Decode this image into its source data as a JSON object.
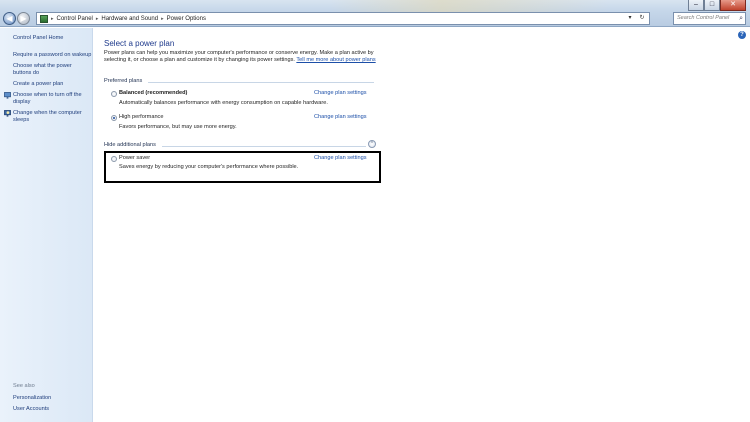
{
  "window": {
    "minimize_glyph": "–",
    "maximize_glyph": "□",
    "close_glyph": "✕"
  },
  "nav": {
    "back_glyph": "◀",
    "forward_glyph": "▶",
    "dropdown_glyph": "▾"
  },
  "address": {
    "crumbs": [
      "Control Panel",
      "Hardware and Sound",
      "Power Options"
    ],
    "separator": "▸",
    "dropdown_glyph": "▾",
    "refresh_glyph": "↻"
  },
  "search": {
    "placeholder": "Search Control Panel",
    "icon_glyph": "⌕"
  },
  "help": {
    "glyph": "?"
  },
  "sidebar": {
    "home": "Control Panel Home",
    "items": [
      {
        "label": "Require a password on wakeup",
        "icon": "none"
      },
      {
        "label": "Choose what the power buttons do",
        "icon": "none"
      },
      {
        "label": "Create a power plan",
        "icon": "none"
      },
      {
        "label": "Choose when to turn off the display",
        "icon": "monitor-icon"
      },
      {
        "label": "Change when the computer sleeps",
        "icon": "moon-icon"
      }
    ],
    "see_also": "See also",
    "see_also_links": [
      "Personalization",
      "User Accounts"
    ]
  },
  "main": {
    "title": "Select a power plan",
    "description": "Power plans can help you maximize your computer's performance or conserve energy. Make a plan active by selecting it, or choose a plan and customize it by changing its power settings.",
    "description_link": "Tell me more about power plans",
    "preferred_header": "Preferred plans",
    "hide_header": "Hide additional plans",
    "collapse_glyph": "⌃",
    "plans": [
      {
        "name": "Balanced (recommended)",
        "description": "Automatically balances performance with energy consumption on capable hardware.",
        "link": "Change plan settings",
        "selected": false,
        "bold": true
      },
      {
        "name": "High performance",
        "description": "Favors performance, but may use more energy.",
        "link": "Change plan settings",
        "selected": true,
        "bold": false
      },
      {
        "name": "Power saver",
        "description": "Saves energy by reducing your computer's performance where possible.",
        "link": "Change plan settings",
        "selected": false,
        "bold": false
      }
    ]
  },
  "colors": {
    "link": "#1c4fa8",
    "title": "#1e3a8c",
    "sidebar_bg": "#dbe8f6",
    "highlight_border": "#000000"
  }
}
